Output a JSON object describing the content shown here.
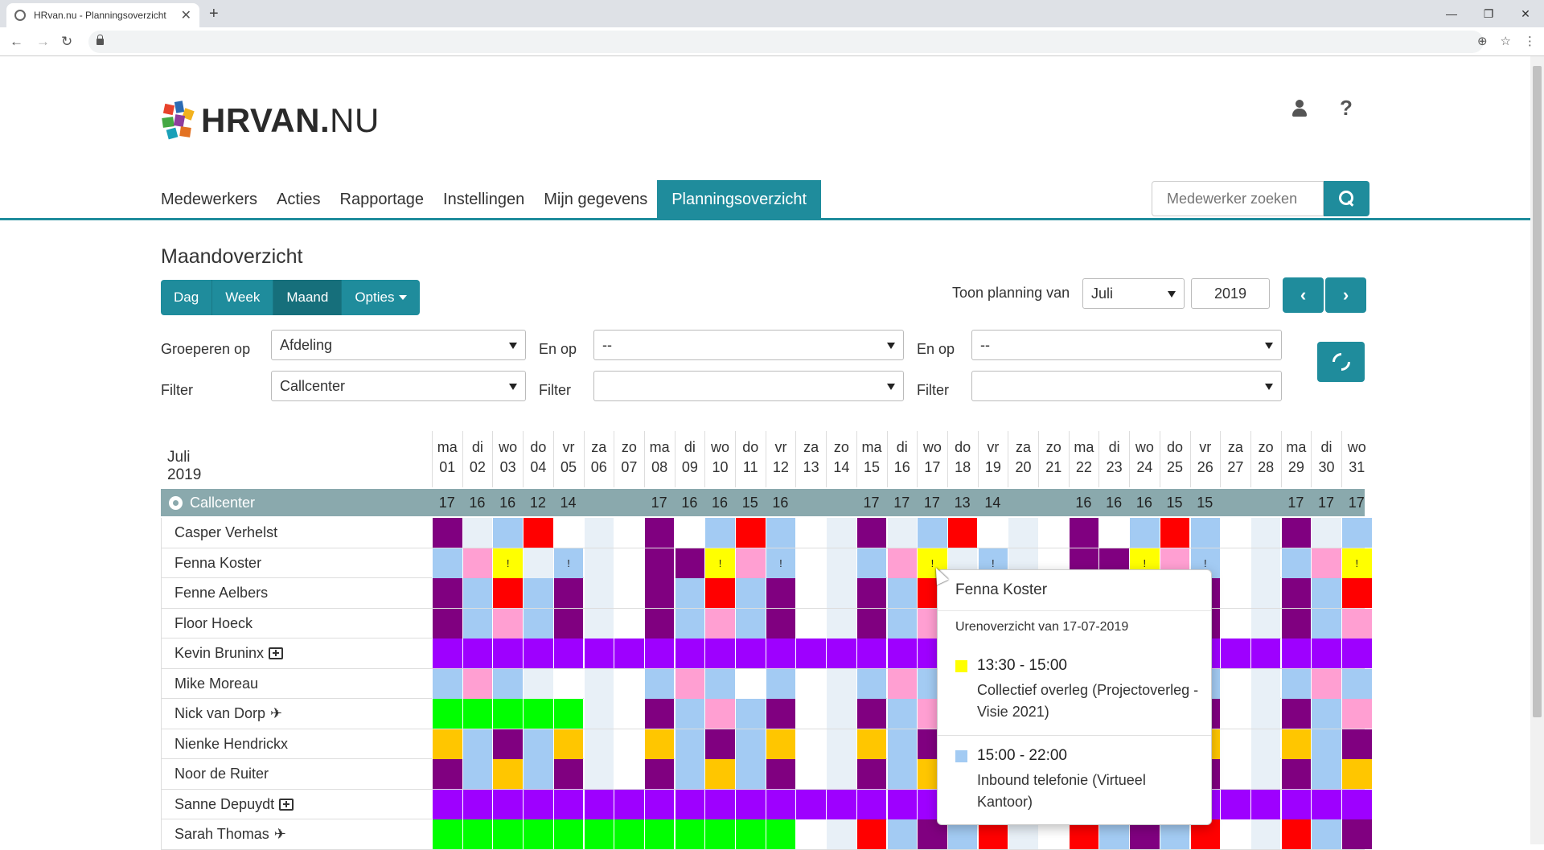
{
  "browser": {
    "tab_title": "HRvan.nu - Planningsoverzicht",
    "tab_close": "✕",
    "new_tab": "+",
    "win_min": "—",
    "win_max": "❐",
    "win_close": "✕",
    "back": "←",
    "forward": "→",
    "reload": "↻",
    "zoom": "⊕",
    "star": "☆",
    "menu": "⋮"
  },
  "header": {
    "logo_bold": "HRVAN.",
    "logo_light": "NU",
    "help": "?"
  },
  "nav": {
    "items": [
      "Medewerkers",
      "Acties",
      "Rapportage",
      "Instellingen",
      "Mijn gegevens",
      "Planningsoverzicht"
    ],
    "active_index": 5
  },
  "search": {
    "placeholder": "Medewerker zoeken"
  },
  "section": {
    "title": "Maandoverzicht",
    "views": [
      "Dag",
      "Week",
      "Maand",
      "Opties"
    ],
    "active_view": "Maand",
    "toon_label": "Toon planning van",
    "month": "Juli",
    "year": "2019",
    "prev": "‹",
    "next": "›"
  },
  "filters": {
    "group_label": "Groeperen op",
    "group_value": "Afdeling",
    "filter_label": "Filter",
    "filter_value": "Callcenter",
    "and_label": "En op",
    "and1_value": "--",
    "and2_value": "--",
    "filter2_value": "",
    "filter3_value": ""
  },
  "calendar": {
    "month_label": "Juli 2019",
    "days": [
      [
        "ma",
        "01"
      ],
      [
        "di",
        "02"
      ],
      [
        "wo",
        "03"
      ],
      [
        "do",
        "04"
      ],
      [
        "vr",
        "05"
      ],
      [
        "za",
        "06"
      ],
      [
        "zo",
        "07"
      ],
      [
        "ma",
        "08"
      ],
      [
        "di",
        "09"
      ],
      [
        "wo",
        "10"
      ],
      [
        "do",
        "11"
      ],
      [
        "vr",
        "12"
      ],
      [
        "za",
        "13"
      ],
      [
        "zo",
        "14"
      ],
      [
        "ma",
        "15"
      ],
      [
        "di",
        "16"
      ],
      [
        "wo",
        "17"
      ],
      [
        "do",
        "18"
      ],
      [
        "vr",
        "19"
      ],
      [
        "za",
        "20"
      ],
      [
        "zo",
        "21"
      ],
      [
        "ma",
        "22"
      ],
      [
        "di",
        "23"
      ],
      [
        "wo",
        "24"
      ],
      [
        "do",
        "25"
      ],
      [
        "vr",
        "26"
      ],
      [
        "za",
        "27"
      ],
      [
        "zo",
        "28"
      ],
      [
        "ma",
        "29"
      ],
      [
        "di",
        "30"
      ],
      [
        "wo",
        "31"
      ]
    ],
    "group": {
      "name": "Callcenter",
      "counts": [
        "17",
        "16",
        "16",
        "12",
        "14",
        "",
        "",
        "17",
        "16",
        "16",
        "15",
        "16",
        "",
        "",
        "17",
        "17",
        "17",
        "13",
        "14",
        "",
        "",
        "16",
        "16",
        "16",
        "15",
        "15",
        "",
        "",
        "17",
        "17",
        "17"
      ]
    },
    "colors": {
      "P": "#800080",
      "L": "#a3cbf3",
      "R": "#ff0000",
      "K": "#ff9fd2",
      "Y": "#ffff00",
      "V": "#9e00ff",
      "G": "#00ff00",
      "O": "#ffc600",
      "E": "#e8f0f7",
      "W": "#ffffff"
    },
    "employees": [
      {
        "name": "Casper Verhelst",
        "icon": "",
        "cells": "PELRWEWPWLRLWEPELRWEWPWLRLWEPEL"
      },
      {
        "name": "Fenna Koster",
        "icon": "",
        "cells": "LKYELEWPPYKLWELKYELEWPPYKLWELKY"
      },
      {
        "name": "Fenne Aelbers",
        "icon": "",
        "cells": "PLRLPEWPLRLPWEPLRLPEWPLRLPWEPLR"
      },
      {
        "name": "Floor Hoeck",
        "icon": "",
        "cells": "PLKLPEWPLKLPWEPLKLPEWPLKLPWEPLK"
      },
      {
        "name": "Kevin Bruninx",
        "icon": "medkit",
        "cells": "VVVVVVVVVVVVVVVVVVVVVVVVVVVVVVV"
      },
      {
        "name": "Mike Moreau",
        "icon": "plane-none",
        "cells": "LKLEWEWLKLWLWELKLEWEWLKLWLWELKL"
      },
      {
        "name": "Nick van Dorp",
        "icon": "plane",
        "cells": "GGGGGEWPLKLPWEPLKLPEWPLKLPWEPLK"
      },
      {
        "name": "Nienke Hendrickx",
        "icon": "",
        "cells": "OLPLOEWOLPLOWEOLPLOEWOLPLOWEOLP"
      },
      {
        "name": "Noor de Ruiter",
        "icon": "",
        "cells": "PLOLPEWPLOLPWEPLOLPEWPLOLPWEPLO"
      },
      {
        "name": "Sanne Depuydt",
        "icon": "medkit",
        "cells": "VVVVVVVVVVVVVVVVVVVVVVVVVVVVVVV"
      },
      {
        "name": "Sarah Thomas",
        "icon": "plane",
        "cells": "GGGGGGGGGGGGWERLPLREWRLPLRWERLP"
      }
    ],
    "alerts": "!"
  },
  "popover": {
    "name": "Fenna Koster",
    "subtitle": "Urenoverzicht van 17-07-2019",
    "items": [
      {
        "time": "13:30 - 15:00",
        "color": "#ffff00",
        "desc": "Collectief overleg (Projectoverleg - Visie 2021)"
      },
      {
        "time": "15:00 - 22:00",
        "color": "#a3cbf3",
        "desc": "Inbound telefonie (Virtueel Kantoor)"
      }
    ]
  }
}
